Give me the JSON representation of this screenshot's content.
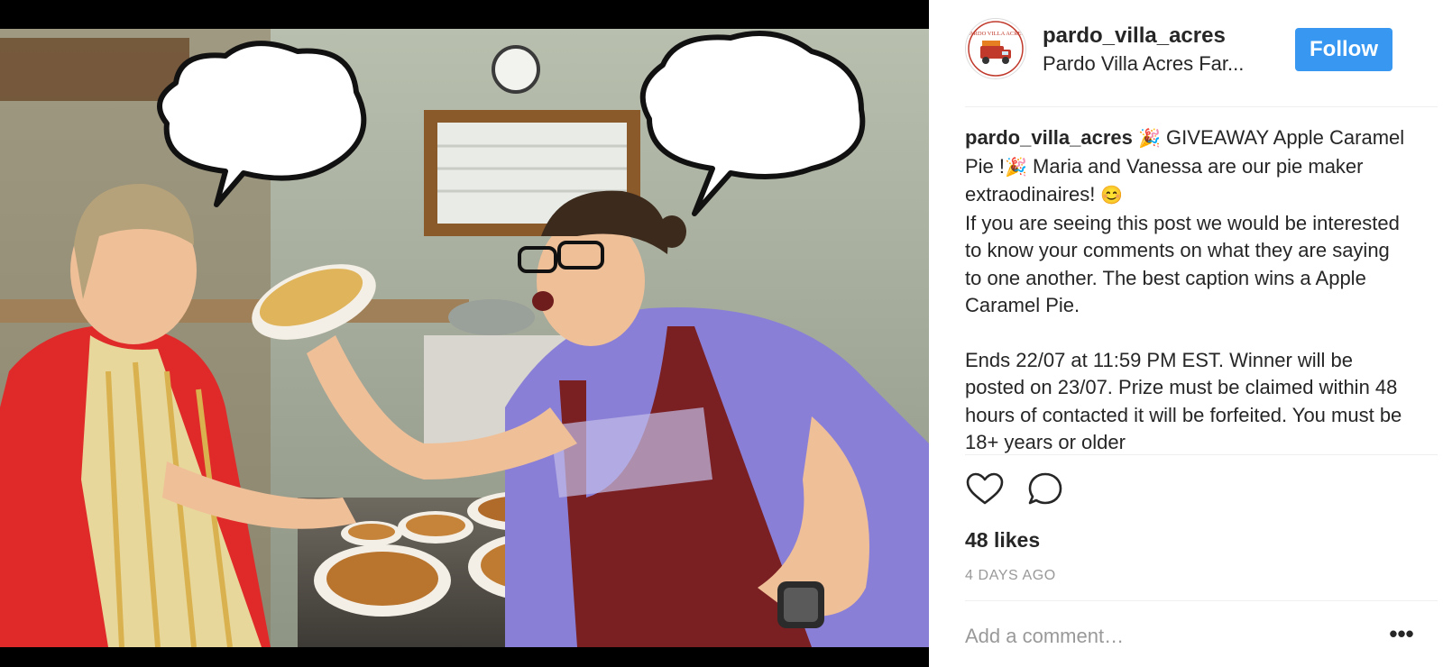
{
  "post": {
    "account": {
      "username": "pardo_villa_acres",
      "display_name": "Pardo Villa Acres Far...",
      "avatar_logo_text": "PARDO VILLA ACRES"
    },
    "follow_label": "Follow",
    "caption": {
      "username": "pardo_villa_acres",
      "emoji_party": "🎉",
      "emoji_smile": "😊",
      "line1_text": " GIVEAWAY Apple Caramel Pie !",
      "line1_tail": " Maria and Vanessa are our pie maker extraodinaires! ",
      "paragraph2": "If you are seeing this post we would be interested to know your comments on what they are saying to one another. The best caption wins a Apple Caramel Pie.",
      "paragraph3": "Ends 22/07 at 11:59 PM EST. Winner will be posted on 23/07. Prize must be claimed within 48 hours of contacted it will be forfeited. You must be 18+ years or older"
    },
    "likes": "48 likes",
    "time_ago": "4 DAYS AGO",
    "comment_placeholder": "Add a comment…",
    "more_label": "•••",
    "icons": [
      "heart-icon",
      "comment-icon",
      "more-options-icon"
    ],
    "colors": {
      "follow_bg": "#3897f0",
      "text": "#262626",
      "muted": "#999999",
      "divider": "#efefef"
    }
  }
}
